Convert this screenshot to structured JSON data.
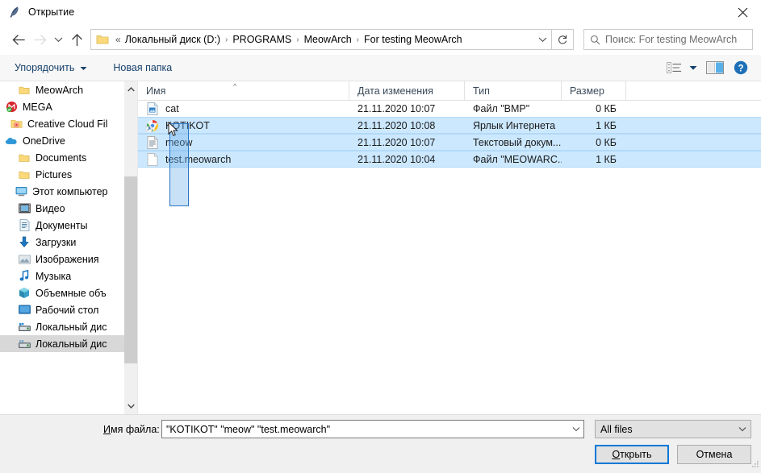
{
  "window": {
    "title": "Открытие",
    "app_icon": "feather-icon",
    "close_label": "✕"
  },
  "navbar": {
    "back_icon": "back-arrow-icon",
    "forward_icon": "forward-arrow-icon",
    "recent_icon": "chevron-down-icon",
    "up_icon": "up-arrow-icon",
    "folder_icon": "folder-icon",
    "breadcrumb_lead": "«",
    "breadcrumbs": [
      "Локальный диск (D:)",
      "PROGRAMS",
      "MeowArch",
      "For testing MeowArch"
    ],
    "separator": "›",
    "dropdown_icon": "chevron-down-icon",
    "refresh_icon": "refresh-icon",
    "search": {
      "icon": "search-icon",
      "placeholder": "Поиск: For testing MeowArch"
    }
  },
  "toolbar": {
    "organize_label": "Упорядочить",
    "organize_caret": "▾",
    "new_folder_label": "Новая папка",
    "view_icon": "view-list-icon",
    "view_caret": "▾",
    "preview_icon": "preview-pane-icon",
    "help_icon": "help-icon"
  },
  "sidebar": {
    "items": [
      {
        "label": "MeowArch",
        "icon": "folder-icon",
        "indent": 1,
        "hovered": false
      },
      {
        "label": "MEGA",
        "icon": "mega-icon",
        "indent": 0,
        "hovered": false
      },
      {
        "label": "Creative Cloud Fil",
        "icon": "creative-cloud-icon",
        "indent": 0,
        "hovered": false
      },
      {
        "label": "OneDrive",
        "icon": "onedrive-icon",
        "indent": 0,
        "hovered": false
      },
      {
        "label": "Documents",
        "icon": "folder-icon",
        "indent": 1,
        "hovered": false
      },
      {
        "label": "Pictures",
        "icon": "folder-icon",
        "indent": 1,
        "hovered": false
      },
      {
        "label": "Этот компьютер",
        "icon": "this-pc-icon",
        "indent": 0,
        "hovered": false
      },
      {
        "label": "Видео",
        "icon": "video-icon",
        "indent": 1,
        "hovered": false
      },
      {
        "label": "Документы",
        "icon": "documents-icon",
        "indent": 1,
        "hovered": false
      },
      {
        "label": "Загрузки",
        "icon": "downloads-icon",
        "indent": 1,
        "hovered": false
      },
      {
        "label": "Изображения",
        "icon": "pictures-icon",
        "indent": 1,
        "hovered": false
      },
      {
        "label": "Музыка",
        "icon": "music-icon",
        "indent": 1,
        "hovered": false
      },
      {
        "label": "Объемные объ",
        "icon": "3d-objects-icon",
        "indent": 1,
        "hovered": false
      },
      {
        "label": "Рабочий стол",
        "icon": "desktop-icon",
        "indent": 1,
        "hovered": false
      },
      {
        "label": "Локальный дис",
        "icon": "local-disk-icon",
        "indent": 1,
        "hovered": false
      },
      {
        "label": "Локальный дис",
        "icon": "local-disk-icon",
        "indent": 1,
        "hovered": true
      }
    ],
    "scroll_up_icon": "chevron-up-icon",
    "scroll_down_icon": "chevron-down-icon"
  },
  "filelist": {
    "columns": [
      {
        "label": "Имя",
        "key": "name"
      },
      {
        "label": "Дата изменения",
        "key": "date"
      },
      {
        "label": "Тип",
        "key": "type"
      },
      {
        "label": "Размер",
        "key": "size"
      }
    ],
    "sort_indicator": "^",
    "rows": [
      {
        "name": "cat",
        "date": "21.11.2020 10:07",
        "type": "Файл \"BMP\"",
        "size": "0 КБ",
        "icon": "bmp-file-icon",
        "selected": false
      },
      {
        "name": "KOTIKOT",
        "date": "21.11.2020 10:08",
        "type": "Ярлык Интернета",
        "size": "1 КБ",
        "icon": "chrome-shortcut-icon",
        "selected": true
      },
      {
        "name": "meow",
        "date": "21.11.2020 10:07",
        "type": "Текстовый докум...",
        "size": "0 КБ",
        "icon": "text-file-icon",
        "selected": true
      },
      {
        "name": "test.meowarch",
        "date": "21.11.2020 10:04",
        "type": "Файл \"MEOWARC...",
        "size": "1 КБ",
        "icon": "blank-file-icon",
        "selected": true
      }
    ],
    "selection_rectangle": {
      "visible": true
    },
    "cursor": {
      "icon": "mouse-pointer-icon"
    }
  },
  "footer": {
    "filename_label": "Имя файла:",
    "filename_label_accel": "И",
    "filename_label_rest": "мя файла:",
    "filename_value": "\"KOTIKOT\" \"meow\" \"test.meowarch\"",
    "filename_dropdown_icon": "chevron-down-icon",
    "filetype_value": "All files",
    "filetype_dropdown_icon": "chevron-down-icon",
    "open_button": "Открыть",
    "open_button_accel": "О",
    "open_button_rest": "ткрыть",
    "cancel_button": "Отмена"
  },
  "colors": {
    "selection": "#cce8ff",
    "accent": "#0078d7",
    "toolbar_bg": "#f7f7f7",
    "footer_bg": "#f0f0f0",
    "link_text": "#17406b"
  }
}
